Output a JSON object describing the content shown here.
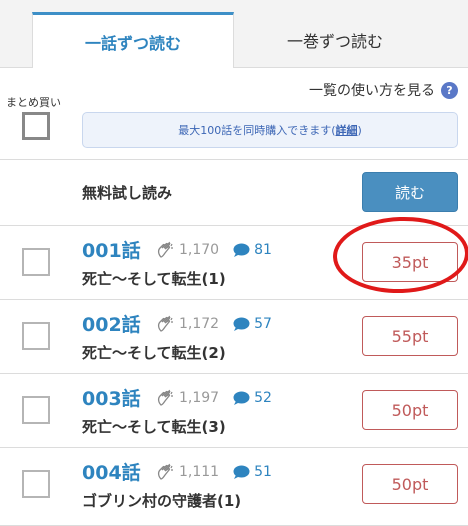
{
  "tabs": [
    {
      "label": "一話ずつ読む",
      "active": true
    },
    {
      "label": "一巻ずつ読む",
      "active": false
    }
  ],
  "bulk": {
    "label": "まとめ買い",
    "howto": "一覧の使い方を見る",
    "help": "?",
    "notice_text": "最大100話を同時購入できます(",
    "notice_link": "詳細",
    "notice_close": ")"
  },
  "trial": {
    "label": "無料試し読み",
    "button": "読む"
  },
  "episodes": [
    {
      "number": "001話",
      "claps": "1,170",
      "comments": "81",
      "title": "死亡〜そして転生(1)",
      "price": "35pt"
    },
    {
      "number": "002話",
      "claps": "1,172",
      "comments": "57",
      "title": "死亡〜そして転生(2)",
      "price": "55pt"
    },
    {
      "number": "003話",
      "claps": "1,197",
      "comments": "52",
      "title": "死亡〜そして転生(3)",
      "price": "50pt"
    },
    {
      "number": "004話",
      "claps": "1,111",
      "comments": "51",
      "title": "ゴブリン村の守護者(1)",
      "price": "50pt"
    }
  ],
  "colors": {
    "accent": "#2e84bf",
    "price": "#c05a5a",
    "annotation": "#e01919"
  }
}
